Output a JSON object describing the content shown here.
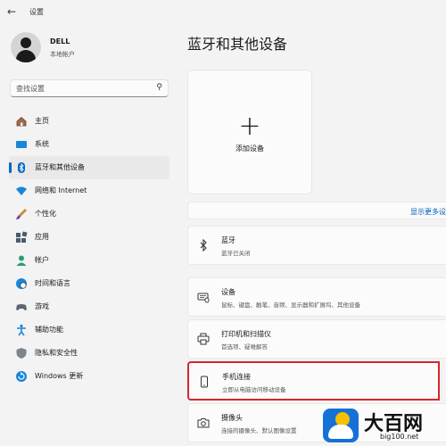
{
  "window": {
    "title": "设置",
    "back_icon": "arrow-left-icon"
  },
  "user": {
    "name": "DELL",
    "account_type": "本地帐户"
  },
  "search": {
    "placeholder": "查找设置"
  },
  "sidebar": {
    "items": [
      {
        "label": "主页",
        "icon": "home-icon",
        "active": false
      },
      {
        "label": "系统",
        "icon": "monitor-icon",
        "active": false
      },
      {
        "label": "蓝牙和其他设备",
        "icon": "bluetooth-icon",
        "active": true
      },
      {
        "label": "网络和 Internet",
        "icon": "wifi-icon",
        "active": false
      },
      {
        "label": "个性化",
        "icon": "brush-icon",
        "active": false
      },
      {
        "label": "应用",
        "icon": "apps-icon",
        "active": false
      },
      {
        "label": "帐户",
        "icon": "person-icon",
        "active": false
      },
      {
        "label": "时间和语言",
        "icon": "globe-clock-icon",
        "active": false
      },
      {
        "label": "游戏",
        "icon": "gamepad-icon",
        "active": false
      },
      {
        "label": "辅助功能",
        "icon": "accessibility-icon",
        "active": false
      },
      {
        "label": "隐私和安全性",
        "icon": "shield-icon",
        "active": false
      },
      {
        "label": "Windows 更新",
        "icon": "refresh-icon",
        "active": false
      }
    ]
  },
  "main": {
    "title": "蓝牙和其他设备",
    "add_device": {
      "label": "添加设备",
      "icon": "plus-icon"
    },
    "more_link": "显示更多设",
    "cards": [
      {
        "title": "蓝牙",
        "subtitle": "蓝牙已关闭",
        "icon": "bluetooth-icon"
      },
      {
        "title": "设备",
        "subtitle": "鼠标、键盘、触笔、音频、显示器和扩展坞、其他设备",
        "icon": "keyboard-mouse-icon"
      },
      {
        "title": "打印机和扫描仪",
        "subtitle": "首选项、疑难解答",
        "icon": "printer-icon"
      },
      {
        "title": "手机连接",
        "subtitle": "立即从电脑访问移动设备",
        "icon": "phone-icon",
        "highlighted": true
      },
      {
        "title": "摄像头",
        "subtitle": "连接的摄像头、默认图像设置",
        "icon": "camera-icon"
      }
    ]
  },
  "watermark": {
    "brand": "大百网",
    "url": "big100.net"
  },
  "colors": {
    "accent": "#0067c0",
    "highlight_border": "#d6262e",
    "link": "#005fb8"
  }
}
